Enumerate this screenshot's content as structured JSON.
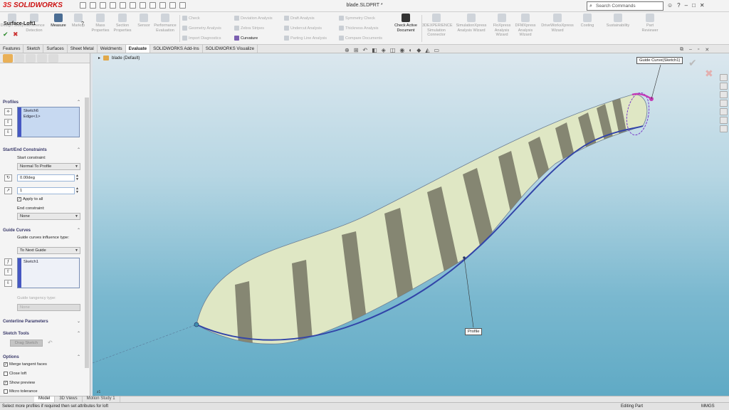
{
  "app": {
    "logo_prefix": "3S",
    "logo": "SOLIDWORKS",
    "doc_title": "blade.SLDPRT *"
  },
  "search": {
    "placeholder": "Search Commands"
  },
  "toolbar": {
    "big_buttons": [
      {
        "label": "Design Study",
        "active": false
      },
      {
        "label": "Interference Detection",
        "active": false
      },
      {
        "label": "Measure",
        "active": true
      },
      {
        "label": "Markup",
        "active": false
      },
      {
        "label": "Mass Properties",
        "active": false
      },
      {
        "label": "Section Properties",
        "active": false
      },
      {
        "label": "Sensor",
        "active": false
      },
      {
        "label": "Performance Evaluation",
        "active": false
      }
    ],
    "small_col1": [
      {
        "label": "Check",
        "active": false
      },
      {
        "label": "Geometry Analysis",
        "active": false
      },
      {
        "label": "Import Diagnostics",
        "active": false
      }
    ],
    "small_col2": [
      {
        "label": "Deviation Analysis",
        "active": false
      },
      {
        "label": "Zebra Stripes",
        "active": false
      },
      {
        "label": "Curvature",
        "active": true
      }
    ],
    "small_col3": [
      {
        "label": "Draft Analysis",
        "active": false
      },
      {
        "label": "Undercut Analysis",
        "active": false
      },
      {
        "label": "Parting Line Analysis",
        "active": false
      }
    ],
    "small_col4": [
      {
        "label": "Symmetry Check",
        "active": false
      },
      {
        "label": "Thickness Analysis",
        "active": false
      },
      {
        "label": "Compare Documents",
        "active": false
      }
    ],
    "check_active": "Check Active Document",
    "right_buttons": [
      {
        "label": "3DEXPERIENCE Simulation Connector"
      },
      {
        "label": "SimulationXpress Analysis Wizard"
      },
      {
        "label": "FloXpress Analysis Wizard"
      },
      {
        "label": "DFMXpress Analysis Wizard"
      },
      {
        "label": "DriveWorksXpress Wizard"
      },
      {
        "label": "Costing"
      },
      {
        "label": "Sustainability"
      },
      {
        "label": "Part Reviewer"
      }
    ]
  },
  "tabs": [
    {
      "label": "Features",
      "active": false
    },
    {
      "label": "Sketch",
      "active": false
    },
    {
      "label": "Surfaces",
      "active": false
    },
    {
      "label": "Sheet Metal",
      "active": false
    },
    {
      "label": "Weldments",
      "active": false
    },
    {
      "label": "Evaluate",
      "active": true
    },
    {
      "label": "SOLIDWORKS Add-Ins",
      "active": false
    },
    {
      "label": "SOLIDWORKS Visualize",
      "active": false
    }
  ],
  "property_manager": {
    "title": "Surface-Loft1",
    "help": "?",
    "profiles": {
      "heading": "Profiles",
      "items": [
        "Sketch6",
        "Edge<1>"
      ]
    },
    "constraints": {
      "heading": "Start/End Constraints",
      "start_label": "Start constraint:",
      "start_value": "Normal To Profile",
      "angle_value": "0.00deg",
      "length_value": "1",
      "apply_all": "Apply to all",
      "end_label": "End constraint:",
      "end_value": "None"
    },
    "guide": {
      "heading": "Guide Curves",
      "influence_label": "Guide curves influence type:",
      "influence_value": "To Next Guide",
      "items": [
        "Sketch1"
      ],
      "tangency_label": "Guide tangency type:",
      "tangency_value": "None"
    },
    "centerline": {
      "heading": "Centerline Parameters"
    },
    "sketch_tools": {
      "heading": "Sketch Tools",
      "drag_button": "Drag Sketch"
    },
    "options": {
      "heading": "Options",
      "merge": "Merge tangent faces",
      "close": "Close loft",
      "preview": "Show preview",
      "micro": "Micro tolerance"
    }
  },
  "viewport": {
    "tree_label": "blade  (Default)",
    "callout_guide": "Guide Curve(Sketch1)",
    "callout_profile": "Profile",
    "z_indicator": "z1"
  },
  "bottom_tabs": [
    {
      "label": "Model",
      "active": true
    },
    {
      "label": "3D Views",
      "active": false
    },
    {
      "label": "Motion Study 1",
      "active": false
    }
  ],
  "status": {
    "message": "Select more profiles if required then set attributes for loft",
    "mode": "Editing Part",
    "units": "MMGS"
  },
  "colors": {
    "guide_curve": "#c33ab5",
    "profile_curve": "#3244a8",
    "stripe_dark": "#7c7c6a",
    "stripe_light": "#dfe7c4",
    "accent_orange": "#e9b057"
  }
}
